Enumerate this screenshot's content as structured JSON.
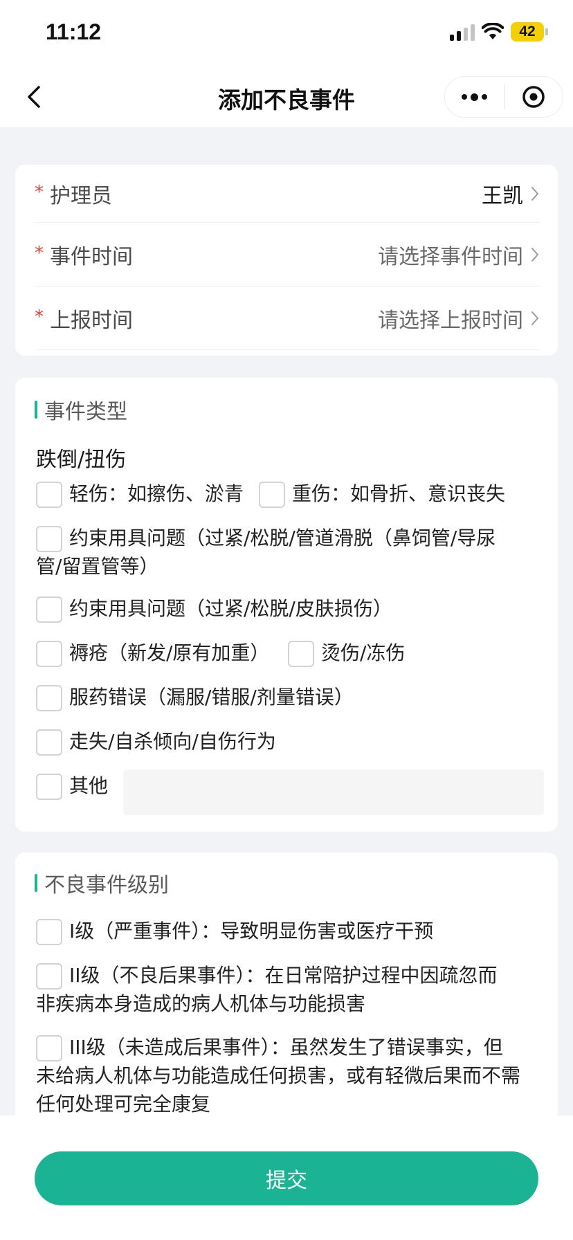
{
  "status": {
    "time": "11:12",
    "battery": "42"
  },
  "nav": {
    "title": "添加不良事件"
  },
  "form": {
    "caregiver_label": "护理员",
    "caregiver_value": "王凯",
    "event_time_label": "事件时间",
    "event_time_placeholder": "请选择事件时间",
    "report_time_label": "上报时间",
    "report_time_placeholder": "请选择上报时间",
    "required_mark": "*"
  },
  "event_type": {
    "title": "事件类型",
    "group": "跌倒/扭伤",
    "options": {
      "minor": "轻伤：如擦伤、淤青",
      "severe": "重伤：如骨折、意识丧失",
      "restraint_tube_line1": "约束用具问题（过紧/松脱/管道滑脱（鼻饲管/导尿",
      "restraint_tube_line2": "管/留置管等）",
      "restraint_skin": "约束用具问题（过紧/松脱/皮肤损伤）",
      "pressure_sore": "褥疮（新发/原有加重）",
      "burn": "烫伤/冻伤",
      "medication": "服药错误（漏服/错服/剂量错误）",
      "wander": "走失/自杀倾向/自伤行为",
      "other": "其他"
    }
  },
  "event_level": {
    "title": "不良事件级别",
    "levels": {
      "l1": "I级（严重事件）：导致明显伤害或医疗干预",
      "l2_line1": "II级（不良后果事件）：在日常陪护过程中因疏忽而",
      "l2_line2": "非疾病本身造成的病人机体与功能损害",
      "l3_line1": "III级（未造成后果事件）：虽然发生了错误事实，但",
      "l3_line2": "未给病人机体与功能造成任何损害，或有轻微后果而不需",
      "l3_line3": "任何处理可完全康复"
    }
  },
  "submit": {
    "label": "提交"
  },
  "colors": {
    "accent": "#1ab394",
    "required": "#e0413a"
  }
}
